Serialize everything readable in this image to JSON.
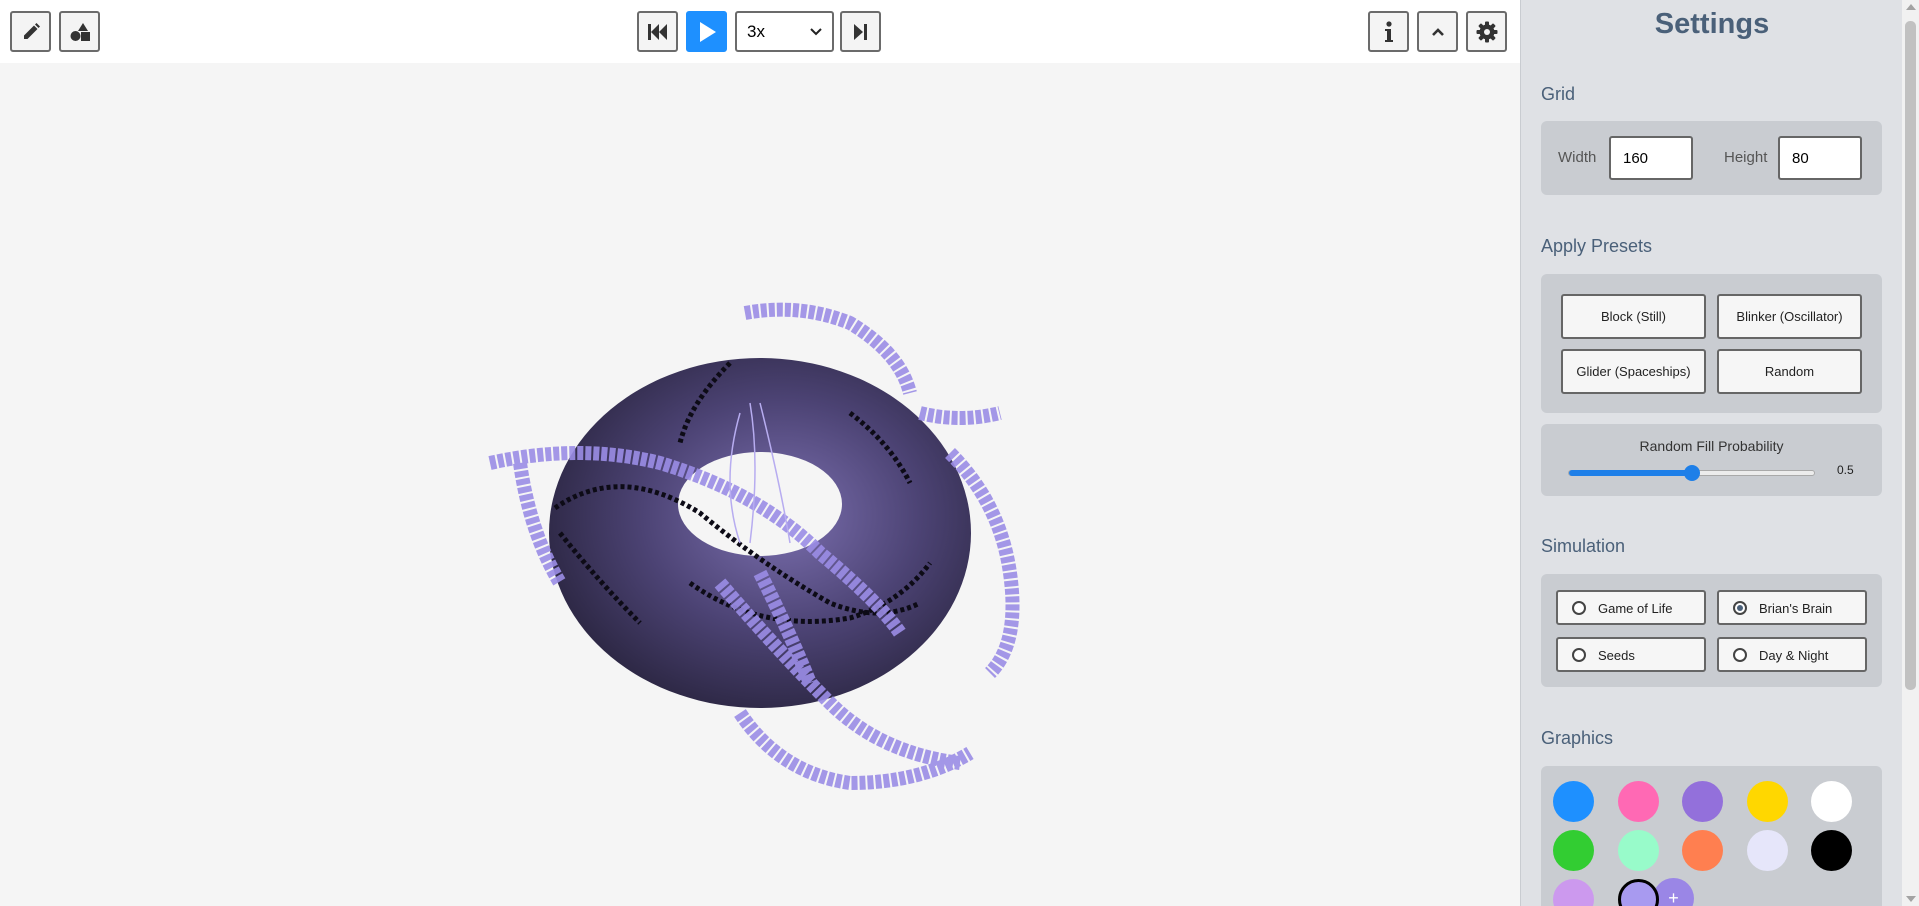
{
  "toolbar": {
    "speed": {
      "value": "3x",
      "options": [
        "3x"
      ]
    },
    "icons": {
      "draw": "pencil-icon",
      "shapes": "shapes-icon",
      "reset": "skip-back-icon",
      "play": "play-icon",
      "step": "step-forward-icon",
      "info": "info-icon",
      "collapse": "chevron-up-icon",
      "settings": "gear-icon"
    },
    "accent_color": "#1e90ff"
  },
  "settings": {
    "title": "Settings",
    "grid": {
      "label": "Grid",
      "width_label": "Width",
      "width_value": "160",
      "height_label": "Height",
      "height_value": "80"
    },
    "presets": {
      "label": "Apply Presets",
      "buttons": [
        "Block (Still)",
        "Blinker (Oscillator)",
        "Glider (Spaceships)",
        "Random"
      ]
    },
    "random_fill": {
      "label": "Random Fill Probability",
      "value": 0.5,
      "value_text": "0.5",
      "min": 0,
      "max": 1
    },
    "simulation": {
      "label": "Simulation",
      "options": [
        "Game of Life",
        "Brian's Brain",
        "Seeds",
        "Day & Night"
      ],
      "selected": "Brian's Brain"
    },
    "graphics": {
      "label": "Graphics",
      "swatches": [
        "#1e90ff",
        "#ff69b4",
        "#9370db",
        "#ffd700",
        "#ffffff",
        "#32cd32",
        "#98fbca",
        "#ff7f50",
        "#e6e6fa",
        "#000000",
        "#cc99ee",
        "#a89af0"
      ],
      "selected_swatch": "#a89af0",
      "add_label": "+"
    }
  },
  "scene": {
    "torus_color": "#5a4f86",
    "cell_color": "#9b8de6"
  }
}
